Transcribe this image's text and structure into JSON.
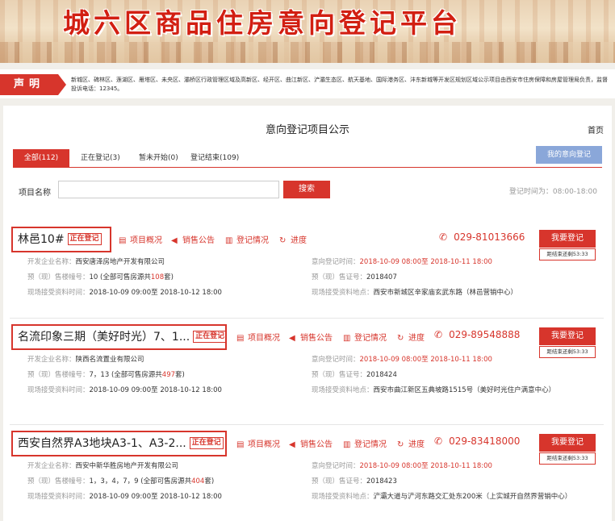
{
  "banner": {
    "title": "城六区商品住房意向登记平台"
  },
  "notice": {
    "tag": "声明",
    "text": "新城区、碑林区、莲湖区、雁塔区、未央区、灞桥区行政管理区域及高新区、经开区、曲江新区、浐灞生态区、航天基地、国际港务区、沣东新城等开发区规划区域公示项目由西安市住房保障和房屋管理局负责，监督投诉电话：12345。"
  },
  "panel": {
    "title": "意向登记项目公示",
    "home": "首页",
    "my_registration": "我的意向登记",
    "tabs": [
      {
        "label": "全部(112)",
        "active": true
      },
      {
        "label": "正在登记(3)",
        "active": false
      },
      {
        "label": "暂未开始(0)",
        "active": false
      },
      {
        "label": "登记结束(109)",
        "active": false
      }
    ],
    "search_label": "项目名称",
    "search_placeholder": "",
    "search_button": "搜索",
    "reg_time": "登记时间为：08:00-18:00"
  },
  "labels": {
    "overview": "项目概况",
    "announce": "销售公告",
    "status": "登记情况",
    "progress": "进度",
    "register": "我要登记",
    "developer": "开发企业名称：",
    "building": "预（现）售楼幢号：",
    "reg_period": "意向登记时间：",
    "permit": "预（现）售证号：",
    "docs_time": "现场接受资料时间：",
    "docs_place": "现场接受资料地点："
  },
  "projects": [
    {
      "name": "林邑10#",
      "status": "正在登记",
      "phone": "029-81013666",
      "countdown": "距结束还剩53:33",
      "developer": "西安唐泽房地产开发有限公司",
      "building": "10",
      "total_pre": "(全部可售房源共",
      "total_num": "108",
      "total_post": "套)",
      "reg_time": "2018-10-09 08:00至 2018-10-11 18:00",
      "permit": "2018407",
      "docs_time": "2018-10-09 09:00至 2018-10-12 18:00",
      "docs_place": "西安市新城区辛家庙玄武东路（林邑营销中心）"
    },
    {
      "name": "名流印象三期（美好时光）7、1...",
      "status": "正在登记",
      "phone": "029-89548888",
      "countdown": "距结束还剩53:33",
      "developer": "陕西名流置业有限公司",
      "building": "7，13",
      "total_pre": "(全部可售房源共",
      "total_num": "497",
      "total_post": "套)",
      "reg_time": "2018-10-09 08:00至 2018-10-11 18:00",
      "permit": "2018424",
      "docs_time": "2018-10-09 09:00至 2018-10-12 18:00",
      "docs_place": "西安市曲江新区五典坡路1515号（美好时光住户满意中心）"
    },
    {
      "name": "西安自然界A3地块A3-1、A3-2...",
      "status": "正在登记",
      "phone": "029-83418000",
      "countdown": "距结束还剩53:33",
      "developer": "西安中新华胜房地产开发有限公司",
      "building": "1，3，4，7，9",
      "total_pre": "(全部可售房源共",
      "total_num": "404",
      "total_post": "套)",
      "reg_time": "2018-10-09 08:00至 2018-10-11 18:00",
      "permit": "2018423",
      "docs_time": "2018-10-09 09:00至 2018-10-12 18:00",
      "docs_place": "浐灞大道与浐河东路交汇处东200米（上实城开自然界营销中心）"
    }
  ]
}
